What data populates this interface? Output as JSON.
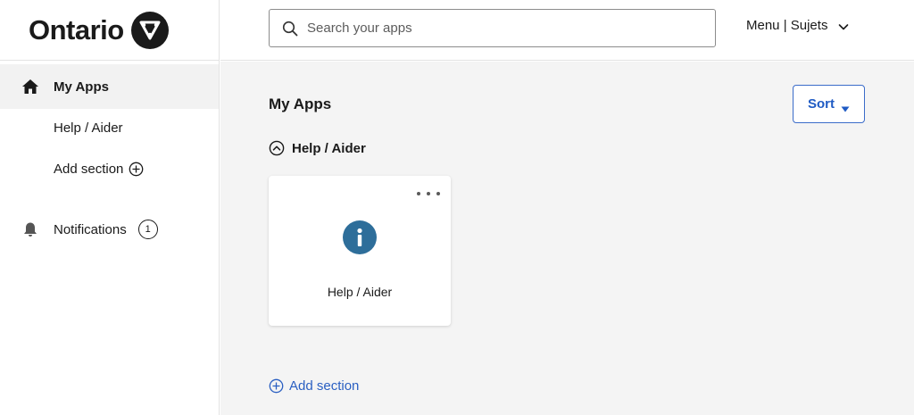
{
  "brand": {
    "name": "Ontario"
  },
  "sidebar": {
    "items": [
      {
        "label": "My Apps",
        "icon": "home-icon"
      },
      {
        "label": "Help / Aider"
      },
      {
        "label": "Add section",
        "icon": "add-circle-icon"
      },
      {
        "label": "Notifications",
        "icon": "bell-icon",
        "count": "1"
      }
    ]
  },
  "header": {
    "search": {
      "placeholder": "Search your apps",
      "value": ""
    },
    "menu_label": "Menu | Sujets"
  },
  "main": {
    "title": "My Apps",
    "sort_label": "Sort",
    "section": {
      "title": "Help / Aider",
      "apps": [
        {
          "label": "Help / Aider",
          "icon": "info-icon"
        }
      ]
    },
    "add_section_label": "Add section"
  },
  "colors": {
    "accent": "#1f5bc4",
    "app_icon": "#2e6e9a",
    "main_bg": "#f4f4f4",
    "active_nav_bg": "#f2f2f2"
  }
}
